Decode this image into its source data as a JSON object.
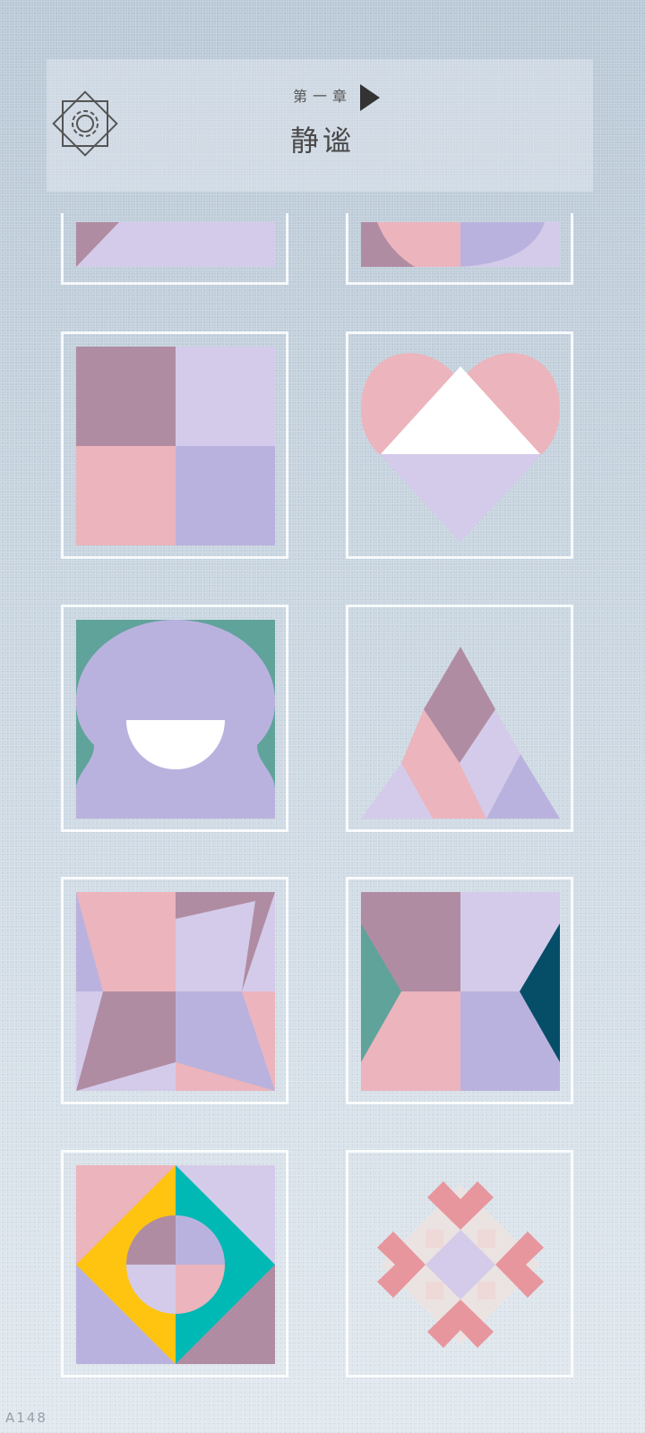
{
  "header": {
    "chapter": "第一章",
    "title": "静谧"
  },
  "icons": {
    "settings": "gear-icon",
    "next": "play-arrow-icon"
  },
  "levels": [
    {
      "id": "level-1",
      "state": "partial"
    },
    {
      "id": "level-2",
      "state": "partial"
    },
    {
      "id": "level-3"
    },
    {
      "id": "level-4"
    },
    {
      "id": "level-5"
    },
    {
      "id": "level-6"
    },
    {
      "id": "level-7"
    },
    {
      "id": "level-8"
    },
    {
      "id": "level-9"
    },
    {
      "id": "level-10"
    }
  ],
  "palette": {
    "mauve": "#b08ca3",
    "lilac": "#d4cbea",
    "pink": "#ecb4bc",
    "lavender": "#bab2de",
    "teal": "#5fa39b",
    "navy": "#064e68",
    "yellow": "#fec410",
    "cyan": "#00b9b5",
    "coral": "#e8969e",
    "cream": "#ebe3e1"
  },
  "version": "A148"
}
